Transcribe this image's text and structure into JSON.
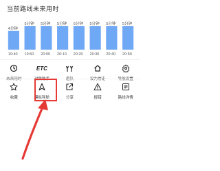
{
  "header": {
    "title": "当前路线未来用时"
  },
  "chart_data": {
    "type": "bar",
    "categories": [
      "19:40",
      "19:50",
      "20:00",
      "20:10",
      "20:20",
      "20:30",
      "20:40",
      "20:50"
    ],
    "value_labels": [
      "4分钟",
      "5分钟",
      "5分钟",
      "5分钟",
      "5分钟",
      "5分钟",
      "5分钟",
      "5分钟"
    ],
    "values": [
      4,
      5,
      5,
      5,
      5,
      5,
      5,
      5
    ],
    "bar_color": "#6fa8f5",
    "text_color": "#555555"
  },
  "toolbar_row1": [
    {
      "icon": "clock-icon",
      "label": "未来用时"
    },
    {
      "icon": "etc-icon",
      "icon_text": "ETC",
      "label": "对我助手"
    },
    {
      "icon": "fork-icon",
      "label": "避队"
    },
    {
      "icon": "home-icon",
      "label": "设为常走"
    },
    {
      "icon": "gear-icon",
      "label": "导航设置"
    }
  ],
  "toolbar_row2": [
    {
      "icon": "star-icon",
      "label": "收藏"
    },
    {
      "icon": "navigation-arrow-icon",
      "label": "模拟导航"
    },
    {
      "icon": "share-icon",
      "label": "分享"
    },
    {
      "icon": "warning-icon",
      "label": "报错"
    },
    {
      "icon": "list-icon",
      "label": "路线详情"
    }
  ],
  "annotation_color": "#e53935"
}
